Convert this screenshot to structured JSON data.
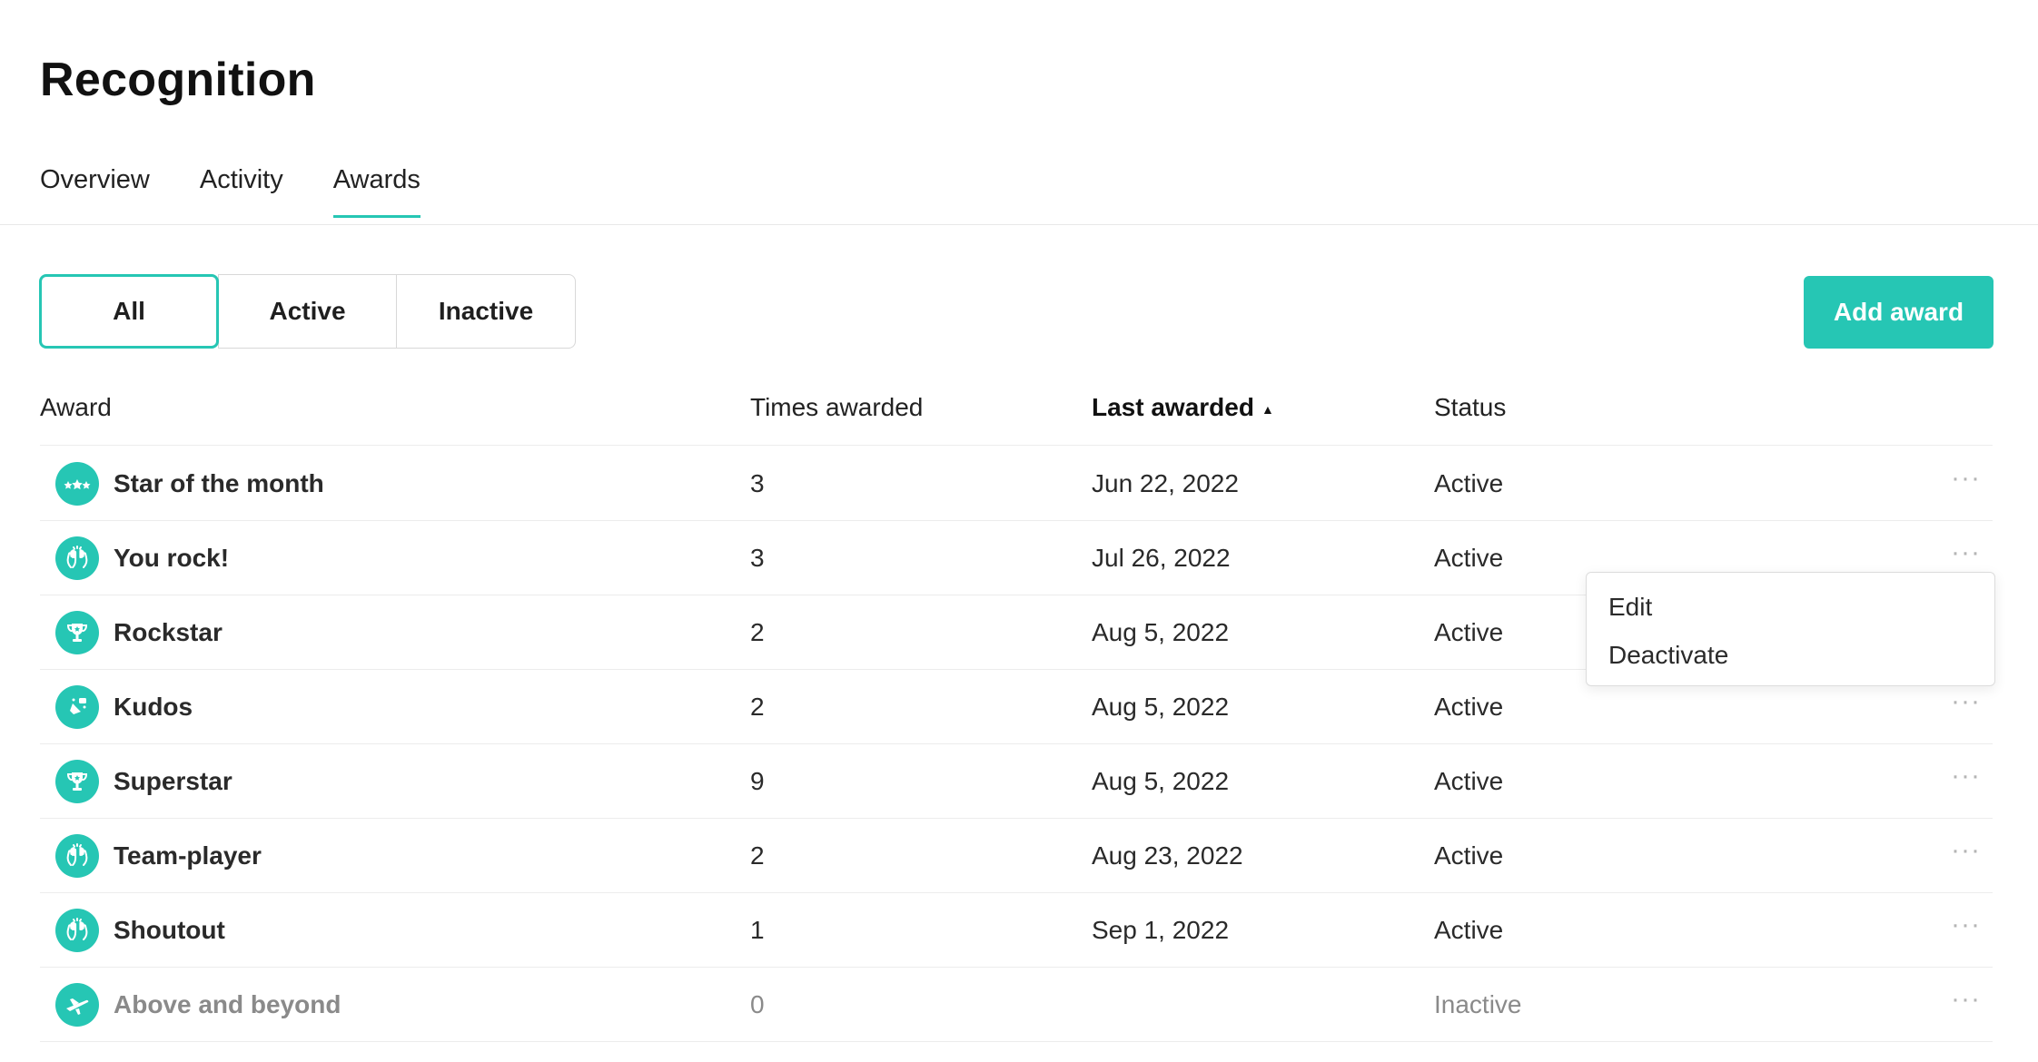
{
  "page": {
    "title": "Recognition"
  },
  "tabs": [
    {
      "label": "Overview"
    },
    {
      "label": "Activity"
    },
    {
      "label": "Awards"
    }
  ],
  "filter": {
    "selected": "All",
    "options": [
      "All",
      "Active",
      "Inactive"
    ]
  },
  "toolbar": {
    "add_award_label": "Add award"
  },
  "table": {
    "columns": [
      "Award",
      "Times awarded",
      "Last awarded",
      "Status"
    ],
    "sorted_column": "Last awarded",
    "rows": [
      {
        "name": "Star of the month",
        "icon": "stars-icon",
        "times": "3",
        "last": "Jun 22, 2022",
        "status": "Active"
      },
      {
        "name": "You rock!",
        "icon": "clap-icon",
        "times": "3",
        "last": "Jul 26, 2022",
        "status": "Active"
      },
      {
        "name": "Rockstar",
        "icon": "trophy-icon",
        "times": "2",
        "last": "Aug 5, 2022",
        "status": "Active"
      },
      {
        "name": "Kudos",
        "icon": "kudos-icon",
        "times": "2",
        "last": "Aug 5, 2022",
        "status": "Active"
      },
      {
        "name": "Superstar",
        "icon": "trophy-icon",
        "times": "9",
        "last": "Aug 5, 2022",
        "status": "Active"
      },
      {
        "name": "Team-player",
        "icon": "clap-icon",
        "times": "2",
        "last": "Aug 23, 2022",
        "status": "Active"
      },
      {
        "name": "Shoutout",
        "icon": "clap-icon",
        "times": "1",
        "last": "Sep 1, 2022",
        "status": "Active"
      },
      {
        "name": "Above and beyond",
        "icon": "plane-icon",
        "times": "0",
        "last": "",
        "status": "Inactive"
      }
    ]
  },
  "row_menu": {
    "items": [
      "Edit",
      "Deactivate"
    ]
  },
  "colors": {
    "accent": "#26c6b4",
    "inactive_text": "#8a8a8a",
    "divider": "#ececec"
  }
}
